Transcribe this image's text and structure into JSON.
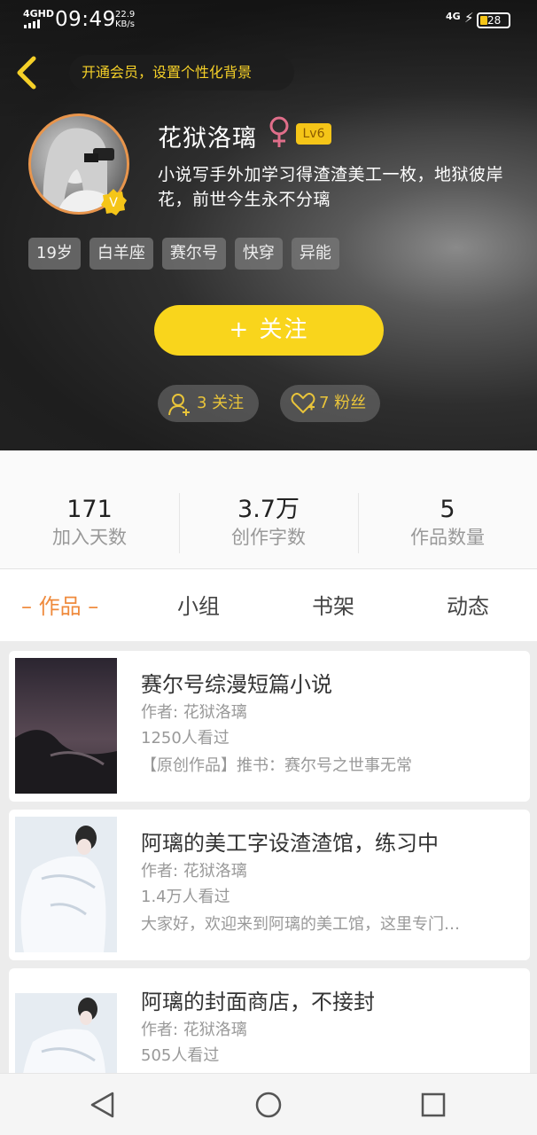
{
  "status_bar": {
    "network": "4GHD",
    "time": "09:49",
    "speed_value": "22.9",
    "speed_unit": "KB/s",
    "network_right": "4G",
    "battery": "28"
  },
  "header": {
    "vip_banner": "开通会员，设置个性化背景"
  },
  "profile": {
    "nickname": "花狱洛璃",
    "level": "Lv6",
    "bio": "小说写手外加学习得渣渣美工一枚，地狱彼岸花，前世今生永不分璃",
    "tags": [
      "19岁",
      "白羊座",
      "赛尔号",
      "快穿",
      "异能"
    ],
    "follow_button": "+  关注",
    "following": "3 关注",
    "fans": "7 粉丝"
  },
  "stats": [
    {
      "value": "171",
      "label": "加入天数"
    },
    {
      "value": "3.7万",
      "label": "创作字数"
    },
    {
      "value": "5",
      "label": "作品数量"
    }
  ],
  "tabs": [
    "– 作品 –",
    "小组",
    "书架",
    "动态"
  ],
  "works": [
    {
      "title": "赛尔号综漫短篇小说",
      "author": "作者: 花狱洛璃",
      "views": "1250人看过",
      "desc": "【原创作品】推书：赛尔号之世事无常"
    },
    {
      "title": "阿璃的美工字设渣渣馆，练习中",
      "author": "作者: 花狱洛璃",
      "views": "1.4万人看过",
      "desc": "大家好，欢迎来到阿璃的美工馆，这里专门…"
    },
    {
      "title": "阿璃的封面商店，不接封",
      "author": "作者: 花狱洛璃",
      "views": "505人看过"
    }
  ],
  "colors": {
    "accent_yellow": "#f9d51c",
    "tab_active": "#ef8a3c",
    "avatar_ring": "#e8954c"
  }
}
